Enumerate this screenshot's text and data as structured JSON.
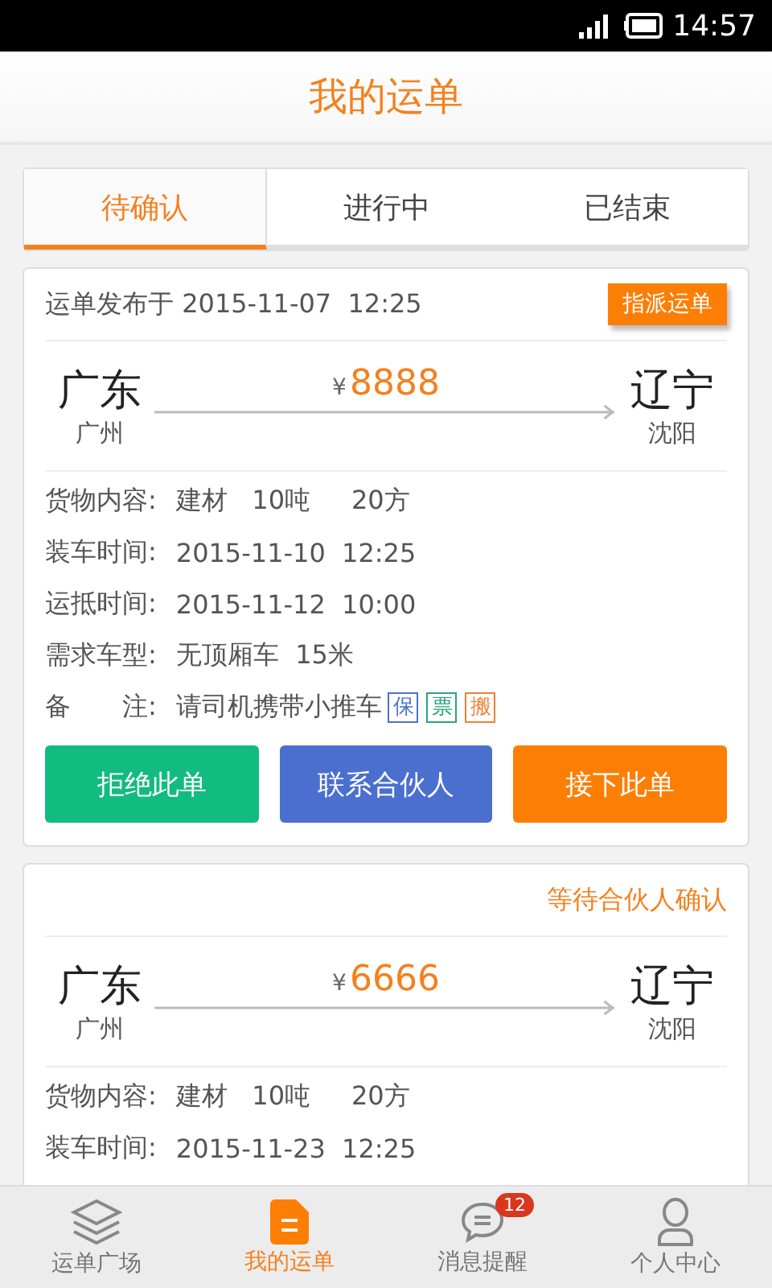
{
  "status_bar": {
    "time": "14:57"
  },
  "header": {
    "title": "我的运单"
  },
  "tabs": [
    {
      "label": "待确认",
      "selected": true
    },
    {
      "label": "进行中",
      "selected": false
    },
    {
      "label": "已结束",
      "selected": false
    }
  ],
  "orders": [
    {
      "published": "运单发布于 2015-11-07  12:25",
      "badge": "指派运单",
      "from": {
        "province": "广东",
        "city": "广州"
      },
      "currency": "¥",
      "price": "8888",
      "to": {
        "province": "辽宁",
        "city": "沈阳"
      },
      "details": [
        {
          "label": "货物内容:",
          "value": "建材   10吨     20方"
        },
        {
          "label": "装车时间:",
          "value": "2015-11-10  12:25"
        },
        {
          "label": "运抵时间:",
          "value": "2015-11-12  10:00"
        },
        {
          "label": "需求车型:",
          "value": "无顶厢车  15米"
        },
        {
          "label": "备　　注:",
          "value": "请司机携带小推车",
          "tags": [
            {
              "text": "保",
              "color": "#4a72c8"
            },
            {
              "text": "票",
              "color": "#2aa67a"
            },
            {
              "text": "搬",
              "color": "#f08030"
            }
          ]
        }
      ],
      "buttons": [
        {
          "label": "拒绝此单",
          "color": "#12bb80"
        },
        {
          "label": "联系合伙人",
          "color": "#4b6fcf"
        },
        {
          "label": "接下此单",
          "color": "#fd7e05"
        }
      ]
    },
    {
      "status": "等待合伙人确认",
      "from": {
        "province": "广东",
        "city": "广州"
      },
      "currency": "¥",
      "price": "6666",
      "to": {
        "province": "辽宁",
        "city": "沈阳"
      },
      "details": [
        {
          "label": "货物内容:",
          "value": "建材   10吨     20方"
        },
        {
          "label": "装车时间:",
          "value": "2015-11-23  12:25"
        }
      ]
    }
  ],
  "nav": [
    {
      "kind": "layers",
      "label": "运单广场",
      "selected": false
    },
    {
      "kind": "document",
      "label": "我的运单",
      "selected": true
    },
    {
      "kind": "chat",
      "label": "消息提醒",
      "selected": false,
      "badge": "12"
    },
    {
      "kind": "person",
      "label": "个人中心",
      "selected": false
    }
  ]
}
